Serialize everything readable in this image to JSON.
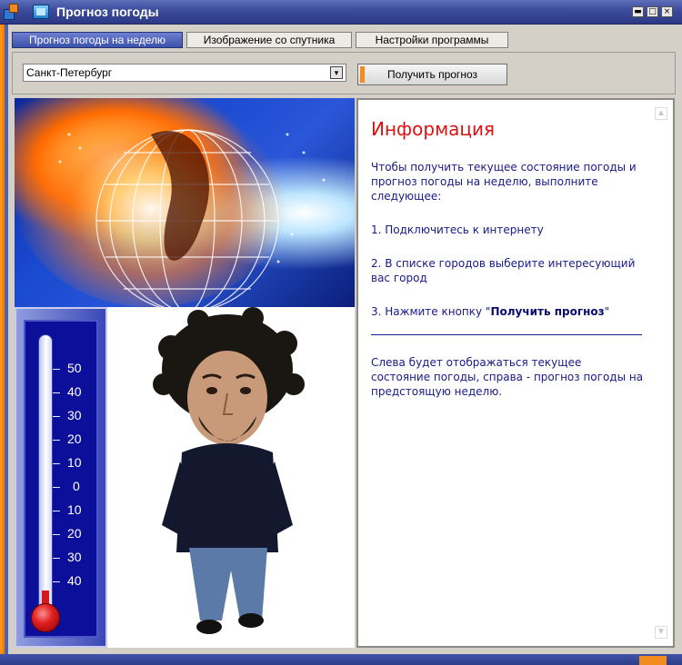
{
  "window": {
    "title": "Прогноз погоды"
  },
  "titlebar_buttons": {
    "minimize": "▬",
    "maximize": "□",
    "close": "×"
  },
  "tabs": [
    {
      "label": "Прогноз погоды на неделю",
      "active": true
    },
    {
      "label": "Изображение со спутника",
      "active": false
    },
    {
      "label": "Настройки программы",
      "active": false
    }
  ],
  "toolbar": {
    "city_value": "Санкт-Петербург",
    "combo_button_glyph": "▾",
    "forecast_button_label": "Получить прогноз"
  },
  "thermometer": {
    "scale_labels": [
      "50",
      "40",
      "30",
      "20",
      "10",
      "0",
      "10",
      "20",
      "30",
      "40"
    ]
  },
  "info": {
    "title": "Информация",
    "intro": "Чтобы получить текущее состояние погоды и прогноз погоды на неделю, выполните следующее:",
    "step1": "1. Подключитесь к интернету",
    "step2": "2. В списке городов выберите интересующий вас город",
    "step3_prefix": "3. Нажмите кнопку \"",
    "step3_bold": "Получить прогноз",
    "step3_suffix": "\"",
    "footer": "Слева будет отображаться текущее состояние погоды, справа - прогноз погоды на предстоящую неделю."
  },
  "colors": {
    "titlebar": "#3b4a9a",
    "accent_orange": "#f28c1e",
    "info_title": "#e01010",
    "info_text": "#1a1a8a"
  }
}
